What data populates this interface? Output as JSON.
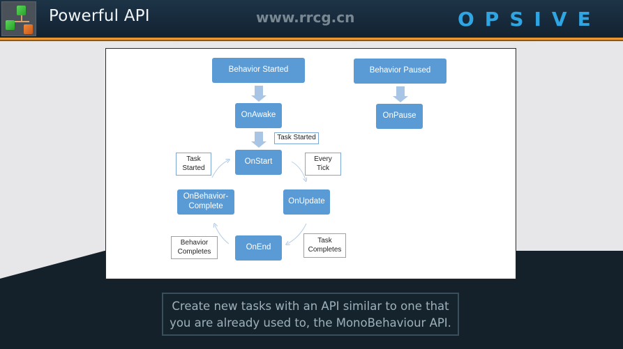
{
  "header": {
    "title": "Powerful API",
    "watermark_site": "www.rrcg.cn",
    "brand": "OPSIVE",
    "colors": {
      "brand_blue": "#2fa5e4",
      "accent_orange": "#f0962a",
      "header_bg": "#1d3447"
    }
  },
  "diagram": {
    "nodes": {
      "behavior_started": "Behavior Started",
      "behavior_paused": "Behavior Paused",
      "on_awake": "OnAwake",
      "on_pause": "OnPause",
      "on_start": "OnStart",
      "on_update": "OnUpdate",
      "on_end": "OnEnd",
      "on_behavior_complete_line1": "OnBehavior-",
      "on_behavior_complete_line2": "Complete"
    },
    "labels": {
      "task_started_top": "Task Started",
      "task_started_left_line1": "Task",
      "task_started_left_line2": "Started",
      "every_tick_line1": "Every",
      "every_tick_line2": "Tick",
      "task_completes_line1": "Task",
      "task_completes_line2": "Completes",
      "behavior_completes_line1": "Behavior",
      "behavior_completes_line2": "Completes"
    },
    "colors": {
      "node_fill": "#5b9bd5",
      "arrow_fill": "#a9c5e6",
      "label_border": "#7aa7d6"
    }
  },
  "caption": {
    "line1": "Create new tasks with an API similar to one that",
    "line2": "you are already used to, the MonoBehaviour API."
  }
}
